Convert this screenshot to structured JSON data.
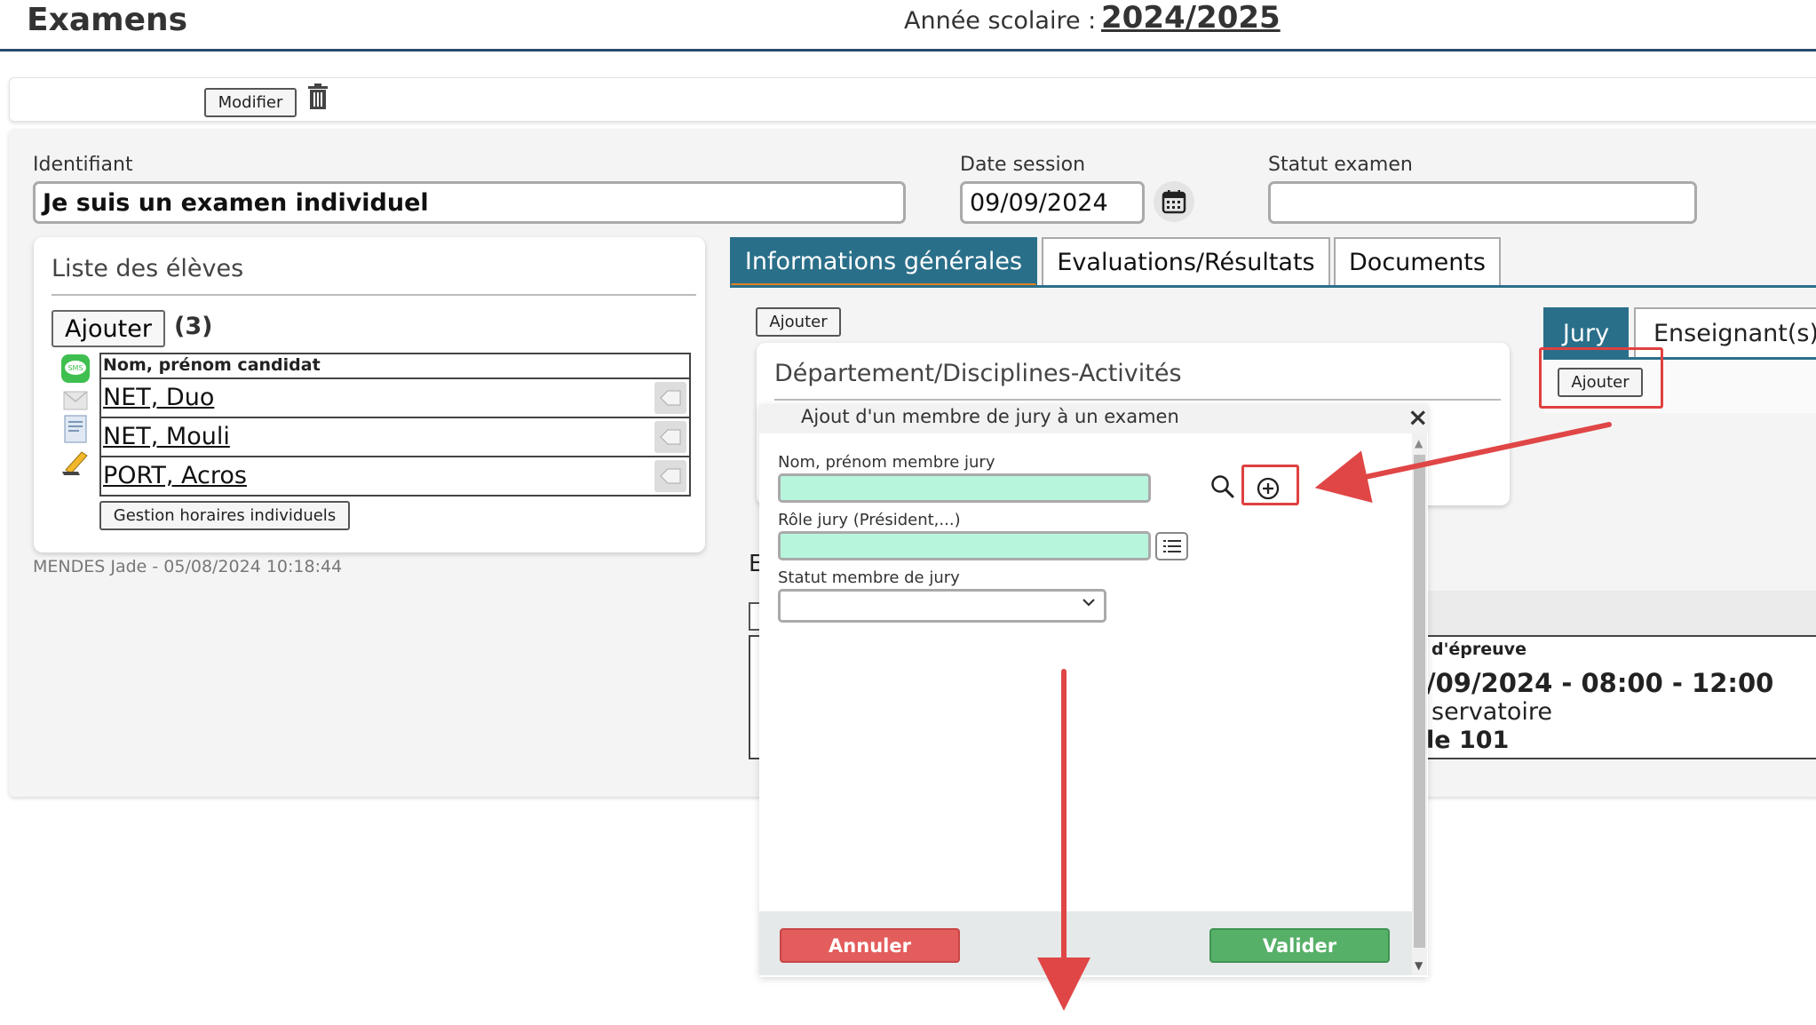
{
  "header": {
    "title": "Examens",
    "year_label": "Année scolaire :",
    "year_value": "2024/2025"
  },
  "toolbar": {
    "modifier_label": "Modifier",
    "trash_icon": "trash-icon"
  },
  "form": {
    "identifiant_label": "Identifiant",
    "identifiant_value": "Je suis un examen individuel",
    "date_label": "Date session",
    "date_value": "09/09/2024",
    "statut_label": "Statut examen",
    "statut_value": ""
  },
  "eleves": {
    "title": "Liste des élèves",
    "add_label": "Ajouter",
    "count": "(3)",
    "column_header": "Nom, prénom candidat",
    "students": [
      {
        "name": "NET, Duo",
        "icon": "sms-icon"
      },
      {
        "name": "NET, Mouli",
        "icon": "document-icon"
      },
      {
        "name": "PORT, Acros",
        "icon": "pencil-icon"
      }
    ],
    "gestion_label": "Gestion horaires individuels",
    "footer": "MENDES Jade - 05/08/2024 10:18:44"
  },
  "tabs": [
    {
      "label": "Informations générales",
      "active": true
    },
    {
      "label": "Evaluations/Résultats",
      "active": false
    },
    {
      "label": "Documents",
      "active": false
    }
  ],
  "info": {
    "add_label": "Ajouter",
    "dept_title": "Département/Disciplines-Activités",
    "jury_tab": "Jury",
    "enseignants_tab": "Enseignant(s)",
    "jury_add_label": "Ajouter",
    "section_letter": "E",
    "col_header": "d'épreuve",
    "line1": "/09/2024 - 08:00 - 12:00",
    "line2": "servatoire",
    "line3": "le 101"
  },
  "modal": {
    "title": "Ajout d'un membre de jury à un examen",
    "close": "×",
    "name_label": "Nom, prénom membre jury",
    "name_value": "",
    "role_label": "Rôle jury (Président,...)",
    "role_value": "",
    "status_label": "Statut membre de jury",
    "status_value": "",
    "cancel_label": "Annuler",
    "submit_label": "Valider"
  },
  "colors": {
    "accent": "#2a6f8a",
    "tab_underline": "#e2801e",
    "highlight": "#e04040",
    "input_fill": "#b8f5dd",
    "cancel": "#e35d5d",
    "submit": "#56b068"
  }
}
